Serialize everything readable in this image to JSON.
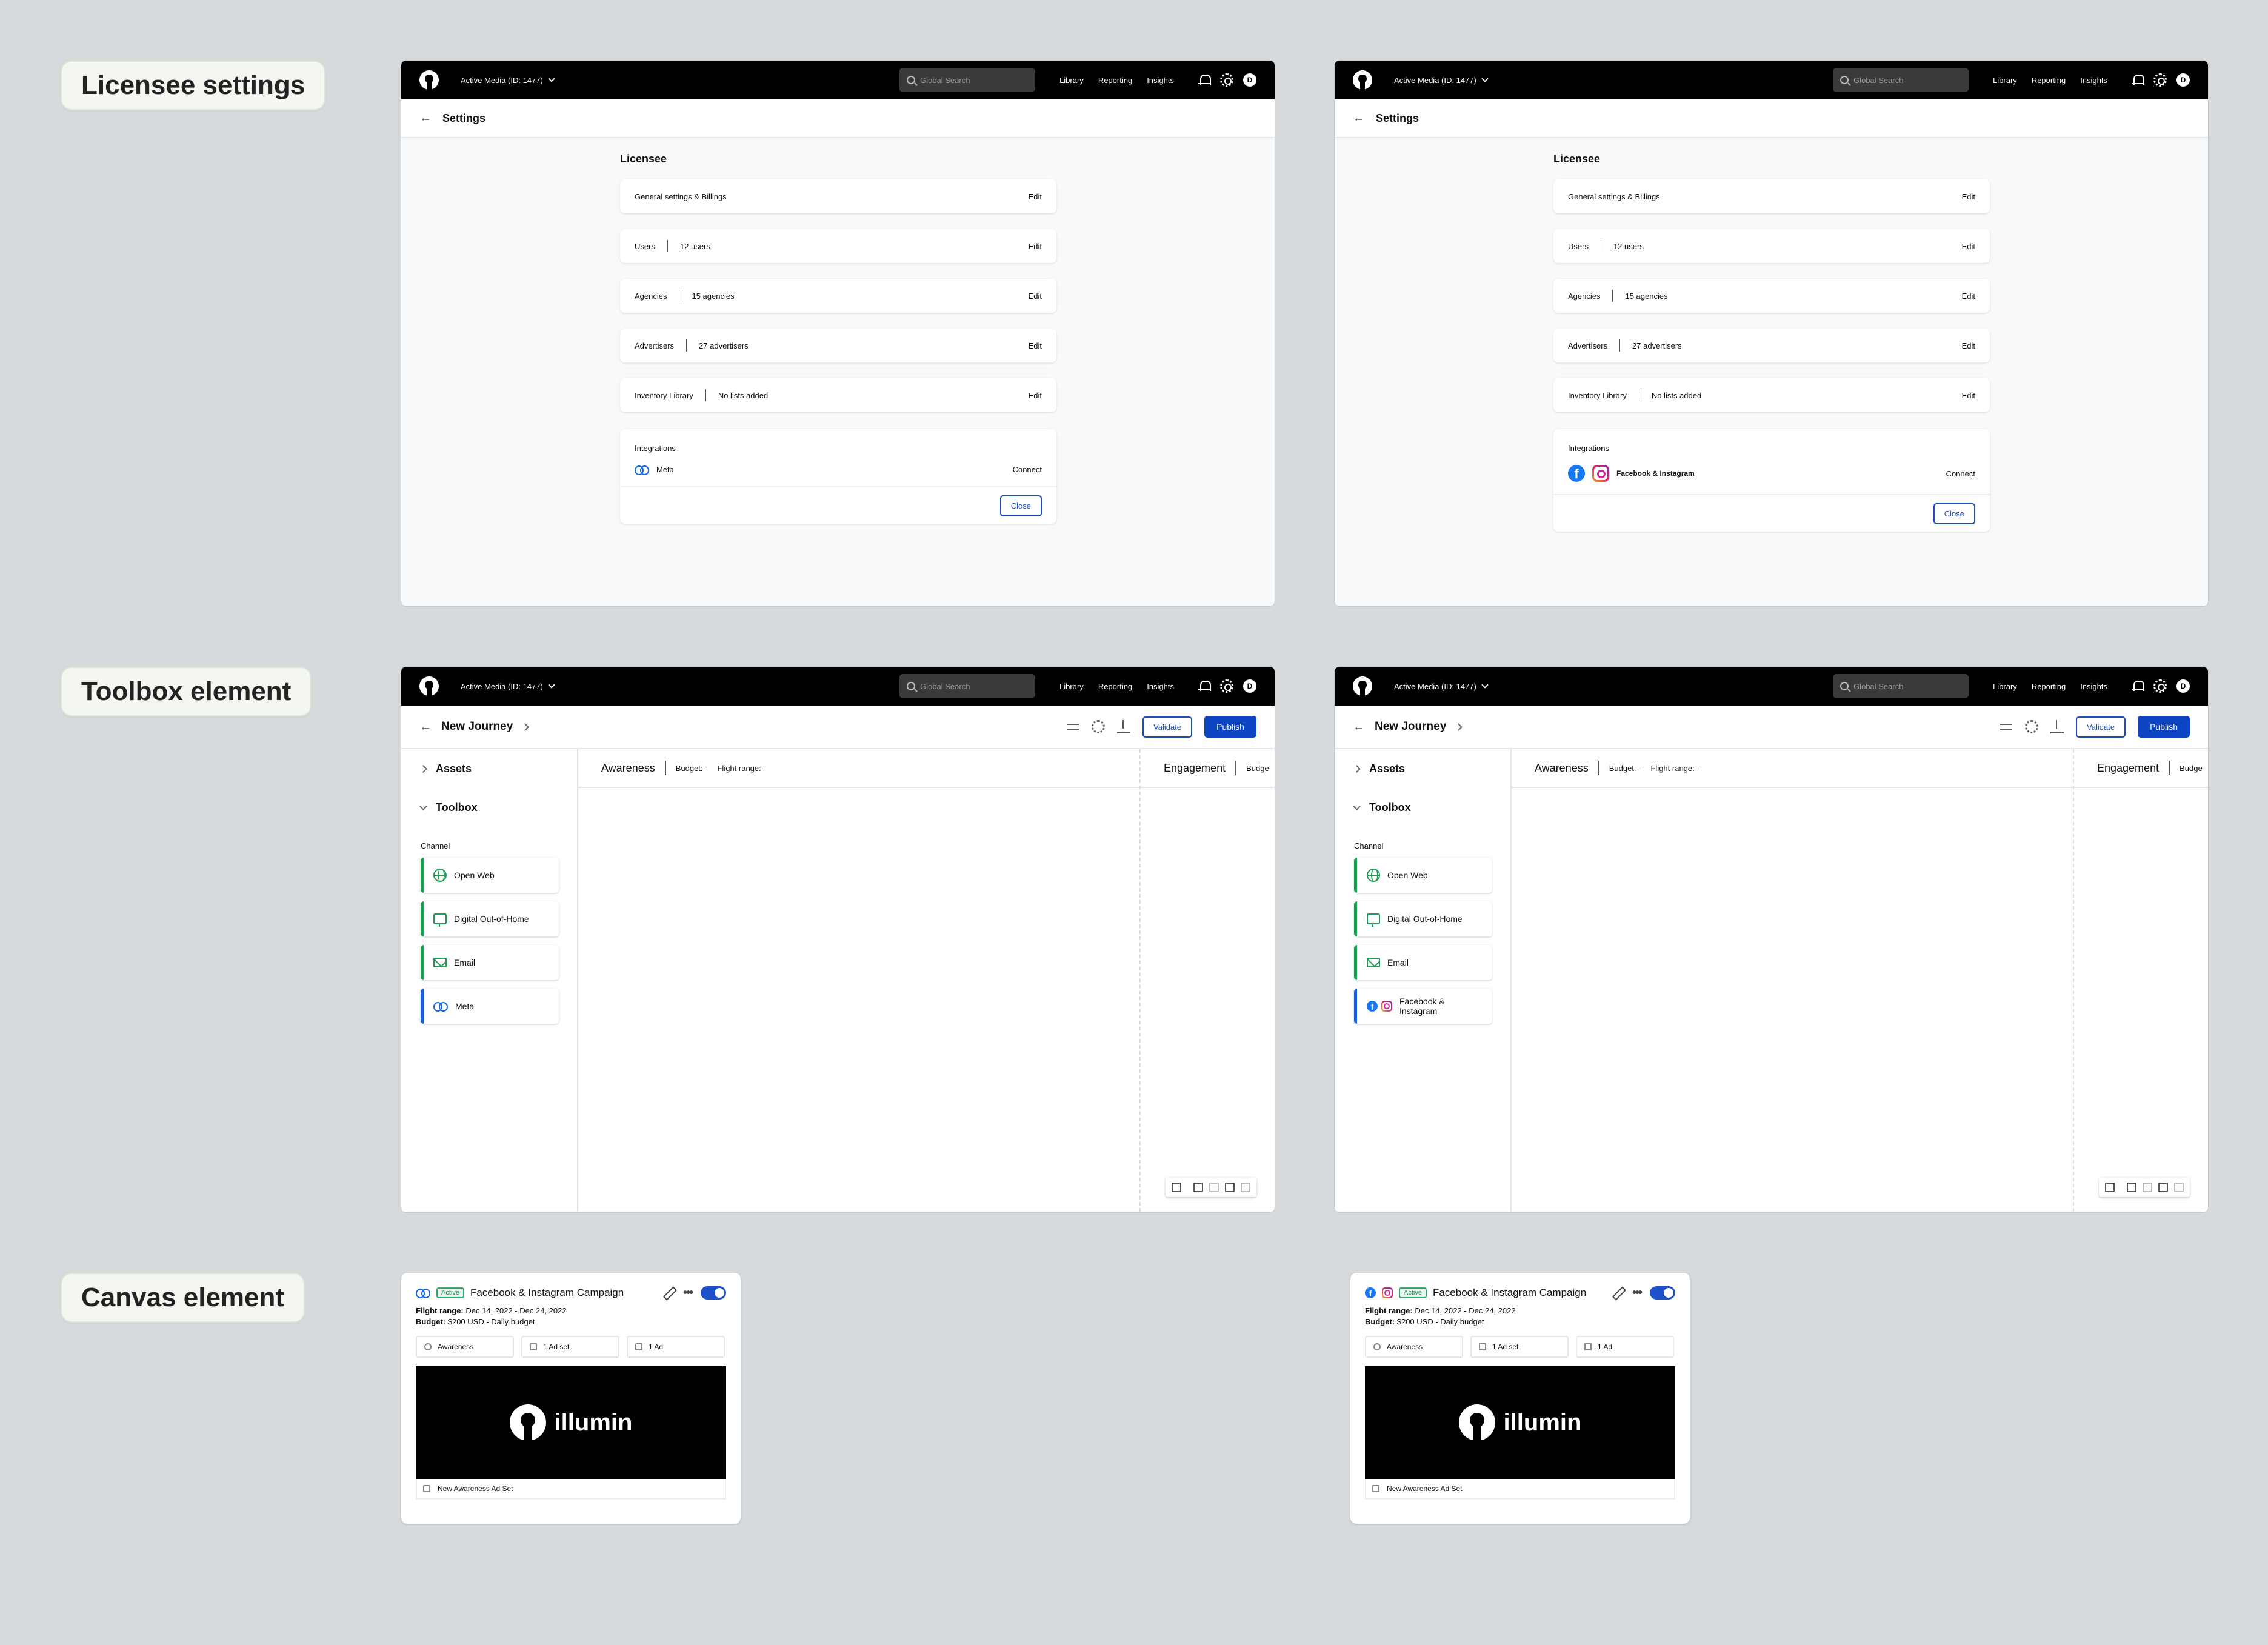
{
  "sections": {
    "licensee": "Licensee settings",
    "toolbox": "Toolbox element",
    "canvas": "Canvas element"
  },
  "topbar": {
    "account": "Active Media (ID: 1477)",
    "search_placeholder": "Global Search",
    "nav": [
      "Library",
      "Reporting",
      "Insights"
    ],
    "avatar": "D"
  },
  "settings": {
    "title": "Settings",
    "heading": "Licensee",
    "rows": [
      {
        "label": "General settings & Billings",
        "value": "",
        "action": "Edit"
      },
      {
        "label": "Users",
        "value": "12 users",
        "action": "Edit"
      },
      {
        "label": "Agencies",
        "value": "15 agencies",
        "action": "Edit"
      },
      {
        "label": "Advertisers",
        "value": "27 advertisers",
        "action": "Edit"
      },
      {
        "label": "Inventory Library",
        "value": "No lists added",
        "action": "Edit"
      }
    ],
    "integrations_title": "Integrations",
    "connect": "Connect",
    "close": "Close",
    "integration_left": "Meta",
    "integration_right": "Facebook & Instagram"
  },
  "journey": {
    "title": "New Journey",
    "validate": "Validate",
    "publish": "Publish",
    "assets": "Assets",
    "toolbox": "Toolbox",
    "channel_label": "Channel",
    "channels": [
      "Open Web",
      "Digital Out-of-Home",
      "Email"
    ],
    "channel_left_last": "Meta",
    "channel_right_last": "Facebook & Instagram",
    "stage1": {
      "name": "Awareness",
      "budget": "Budget: -",
      "flight": "Flight range: -"
    },
    "stage2": {
      "name": "Engagement",
      "budget": "Budge"
    }
  },
  "campaign": {
    "status": "Active",
    "name": "Facebook & Instagram Campaign",
    "flight_label": "Flight range:",
    "flight_value": "Dec 14, 2022 - Dec 24, 2022",
    "budget_label": "Budget:",
    "budget_value": "$200 USD - Daily budget",
    "chips": [
      "Awareness",
      "1 Ad set",
      "1 Ad"
    ],
    "brand": "illumin",
    "adset": "New Awareness Ad Set"
  }
}
